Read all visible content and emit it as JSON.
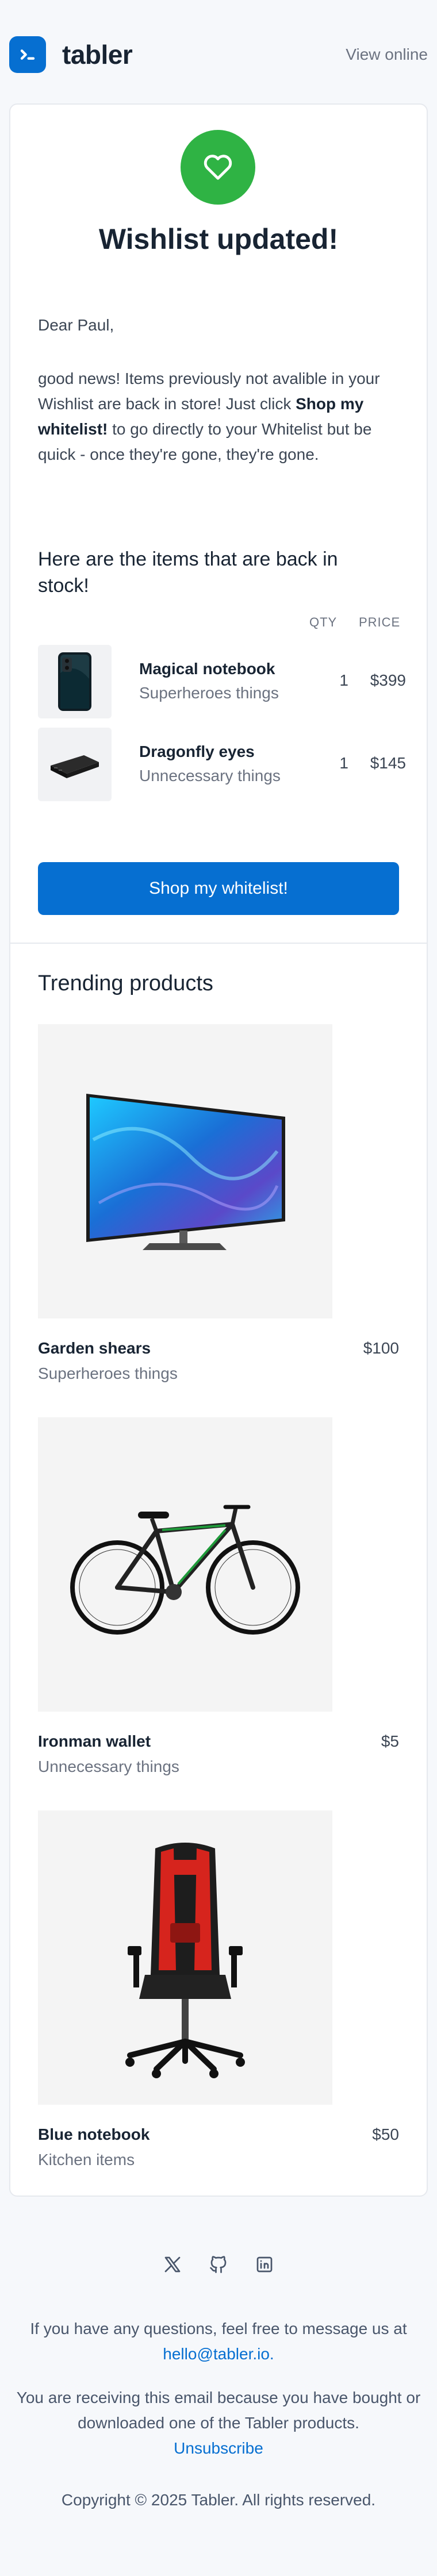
{
  "brand": {
    "name": "tabler"
  },
  "header": {
    "view_online": "View online"
  },
  "hero": {
    "title": "Wishlist updated!"
  },
  "message": {
    "greeting": "Dear Paul,",
    "intro_before": "good news! Items previously not avalible in your Wishlist are back in store! Just click ",
    "intro_bold": "Shop my whitelist!",
    "intro_after": " to go directly to your Whitelist but be quick - once they're gone, they're gone."
  },
  "items_section": {
    "heading": "Here are the items that are back in stock!",
    "col_qty": "QTY",
    "col_price": "PRICE",
    "items": [
      {
        "name": "Magical notebook",
        "subtitle": "Superheroes things",
        "qty": "1",
        "price": "$399"
      },
      {
        "name": "Dragonfly eyes",
        "subtitle": "Unnecessary things",
        "qty": "1",
        "price": "$145"
      }
    ]
  },
  "cta": {
    "label": "Shop my whitelist!"
  },
  "trending": {
    "title": "Trending products",
    "products": [
      {
        "name": "Garden shears",
        "subtitle": "Superheroes things",
        "price": "$100",
        "image": "tv-image"
      },
      {
        "name": "Ironman wallet",
        "subtitle": "Unnecessary things",
        "price": "$5",
        "image": "bicycle-image"
      },
      {
        "name": "Blue notebook",
        "subtitle": "Kitchen items",
        "price": "$50",
        "image": "gaming-chair-image"
      }
    ]
  },
  "footer": {
    "socials": [
      "x-icon",
      "github-icon",
      "linkedin-icon"
    ],
    "questions": "If you have any questions, feel free to message us at",
    "email": "hello@tabler.io.",
    "receiving": "You are receiving this email because you have bought or downloaded one of the Tabler products.",
    "unsubscribe": "Unsubscribe",
    "copyright": "Copyright © 2025 Tabler. All rights reserved."
  },
  "colors": {
    "primary": "#066fd1",
    "success": "#2fb344",
    "background": "#f6f8fb"
  }
}
